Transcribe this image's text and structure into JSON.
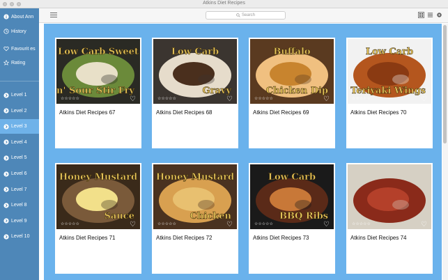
{
  "window": {
    "title": "Atkins Diet Recipes"
  },
  "sidebar": {
    "top_items": [
      {
        "label": "About Ann",
        "icon": "info-icon"
      },
      {
        "label": "History",
        "icon": "clock-icon"
      },
      {
        "label": "Favourit es",
        "icon": "heart-icon"
      },
      {
        "label": "Rating",
        "icon": "star-icon"
      }
    ],
    "levels": [
      {
        "label": "Level 1",
        "active": false
      },
      {
        "label": "Level 2",
        "active": false
      },
      {
        "label": "Level 3",
        "active": true
      },
      {
        "label": "Level 4",
        "active": false
      },
      {
        "label": "Level 5",
        "active": false
      },
      {
        "label": "Level 6",
        "active": false
      },
      {
        "label": "Level 7",
        "active": false
      },
      {
        "label": "Level 8",
        "active": false
      },
      {
        "label": "Level 9",
        "active": false
      },
      {
        "label": "Level 10",
        "active": false
      }
    ]
  },
  "toolbar": {
    "search_placeholder": "Search",
    "icons": [
      "menu-icon",
      "grid-view-icon",
      "list-view-icon",
      "settings-icon"
    ]
  },
  "cards": [
    {
      "title": "Atkins Diet Recipes 67",
      "overlay_top": "Low Carb Sweet",
      "overlay_bottom": "n' Sour Stir Fry",
      "rating": "☆☆☆☆☆",
      "palette": [
        "#2a2a24",
        "#6b8a3a",
        "#e8e0c8"
      ]
    },
    {
      "title": "Atkins Diet Recipes 68",
      "overlay_top": "Low Carb",
      "overlay_bottom": "Gravy",
      "rating": "☆☆☆☆☆",
      "palette": [
        "#3b3530",
        "#e6dccb",
        "#4a2f1d"
      ]
    },
    {
      "title": "Atkins Diet Recipes 69",
      "overlay_top": "Buffalo",
      "overlay_bottom": "Chicken Dip",
      "rating": "☆☆☆☆☆",
      "palette": [
        "#5a3a20",
        "#f0c080",
        "#c8842e"
      ]
    },
    {
      "title": "Atkins Diet Recipes 70",
      "overlay_top": "Low Carb",
      "overlay_bottom": "Teriyaki Wings",
      "rating": "☆☆☆☆☆",
      "palette": [
        "#f2f2f2",
        "#b4561e",
        "#8a3a12"
      ]
    },
    {
      "title": "Atkins Diet Recipes 71",
      "overlay_top": "Honey Mustard",
      "overlay_bottom": "Sauce",
      "rating": "☆☆☆☆☆",
      "palette": [
        "#3a2a1a",
        "#7a5a3a",
        "#f2e08a"
      ]
    },
    {
      "title": "Atkins Diet Recipes 72",
      "overlay_top": "Honey Mustard",
      "overlay_bottom": "Chicken",
      "rating": "☆☆☆☆☆",
      "palette": [
        "#4a3220",
        "#d8a050",
        "#e8c070"
      ]
    },
    {
      "title": "Atkins Diet Recipes 73",
      "overlay_top": "Low Carb",
      "overlay_bottom": "BBQ Ribs",
      "rating": "☆☆☆☆☆",
      "palette": [
        "#1a1a1a",
        "#5a2a18",
        "#c87838"
      ]
    },
    {
      "title": "Atkins Diet Recipes 74",
      "overlay_top": "",
      "overlay_bottom": "",
      "rating": "☆☆☆☆☆",
      "palette": [
        "#d6d0c4",
        "#8a2a1a",
        "#b4402a"
      ]
    }
  ],
  "colors": {
    "sidebar": "#4e87b8",
    "sidebar_active": "#6fb2e9",
    "content_bg": "#6ab2ec",
    "overlay_text": "#e8c65a"
  }
}
